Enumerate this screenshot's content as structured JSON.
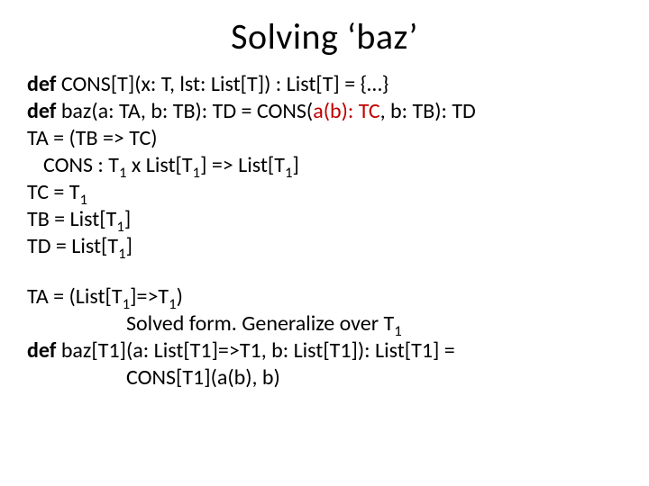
{
  "title": "Solving ‘baz’",
  "lines": {
    "l1_def": "def",
    "l1_rest": " CONS[T](x: T, lst: List[T]) : List[T] = {…}",
    "l2_def": "def",
    "l2_mid": " baz(a: TA, b: TB): TD = CONS(",
    "l2_red": "a(b): TC",
    "l2_tail": ", b: TB): TD",
    "l3": "TA = (TB => TC)",
    "l4_pre": "CONS  :  T",
    "l4_x": " x List[T",
    "l4_arr": "] => List[T",
    "l4_end": "]",
    "l5_pre": "TC = T",
    "l6_pre": "TB = List[T",
    "l6_end": "]",
    "l7_pre": "TD = List[T",
    "l7_end": "]",
    "l8_pre": "TA = (List[T",
    "l8_mid": "]=>T",
    "l8_end": ")",
    "l9_pre": "Solved form. Generalize over T",
    "l10_def": "def",
    "l10_rest": " baz[T1](a: List[T1]=>T1, b: List[T1]): List[T1] =",
    "l11": "CONS[T1](a(b), b)",
    "sub1": "1"
  }
}
